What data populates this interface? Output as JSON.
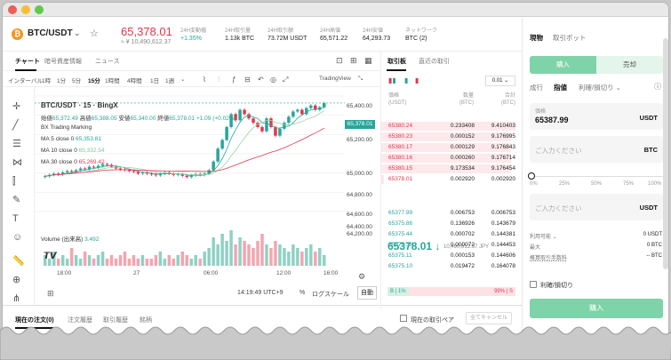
{
  "header": {
    "pair": "BTC/USDT",
    "dropdown": "⌄",
    "price": "65,378.01",
    "price_sub": "≈ ¥ 10,490,612.37",
    "stats": [
      {
        "label": "24H変動幅",
        "value": "+1.35%",
        "color": "#26a69a"
      },
      {
        "label": "24H取引量",
        "value": "1.13k BTC",
        "color": "#222222"
      },
      {
        "label": "24H取引額",
        "value": "73.72M USDT",
        "color": "#222222"
      },
      {
        "label": "24H高値",
        "value": "65,571.22",
        "color": "#222222"
      },
      {
        "label": "24H安値",
        "value": "64,293.73",
        "color": "#222222"
      },
      {
        "label": "ネットワーク",
        "value": "BTC (2)",
        "color": "#222222"
      }
    ]
  },
  "chart_tabs": [
    "チャート",
    "暗号資産情報",
    "ニュース"
  ],
  "intervals": [
    "インターバル",
    "1時",
    "1分",
    "5分",
    "15分",
    "1時間",
    "4時間",
    "1日",
    "1週",
    "⌄"
  ],
  "interval_active": "15分",
  "tradingview": "TradingView",
  "legend": {
    "title": "BTC/USDT · 15 · BingX",
    "ohlc_o_label": "始値",
    "ohlc_o": "65,372.49",
    "ohlc_h_label": "高値",
    "ohlc_h": "65,388.05",
    "ohlc_l_label": "安値",
    "ohlc_l": "65,340.00",
    "ohlc_c_label": "終値",
    "ohlc_c": "65,378.01",
    "ohlc_chg": "+1.09 (+0.02%)",
    "marking": "BX Trading Marking",
    "ma5_label": "MA 5 close 0",
    "ma5": "65,353.81",
    "ma10_label": "MA 10 close 0",
    "ma10": "65,332.54",
    "ma30_label": "MA 30 close 0",
    "ma30": "65,269.42",
    "volume_label": "Volume (出来高)",
    "volume": "3.492"
  },
  "chart_data": {
    "type": "candlestick",
    "y_ticks": [
      "65,400.00",
      "65,200.00",
      "65,000.00",
      "64,800.00",
      "64,600.00",
      "64,400.00",
      "64,200.00"
    ],
    "ylim": [
      64120,
      65460
    ],
    "x_ticks": [
      "18:00",
      "27",
      "06:00",
      "12:00",
      "16:00"
    ],
    "current_price": "65,378.01",
    "current_price_value": 65378.01,
    "closes": [
      64530,
      64545,
      64560,
      64550,
      64575,
      64590,
      64580,
      64600,
      64620,
      64610,
      64640,
      64630,
      64650,
      64670,
      64660,
      64640,
      64620,
      64610,
      64600,
      64590,
      64580,
      64560,
      64570,
      64560,
      64550,
      64540,
      64560,
      64575,
      64560,
      64545,
      64555,
      64535,
      64520,
      64540,
      64555,
      64545,
      64560,
      64600,
      64700,
      64850,
      64950,
      65100,
      65250,
      65180,
      65300,
      65250,
      65200,
      65150,
      65100,
      65050,
      65200,
      65100,
      65000,
      65080,
      65150,
      65220,
      65280,
      65300,
      65250,
      65320,
      65350,
      65300,
      65330,
      65378
    ],
    "ma_series": [
      {
        "name": "MA 5",
        "color": "#26a69a"
      },
      {
        "name": "MA 10",
        "color": "#9bd4a6"
      },
      {
        "name": "MA 30",
        "color": "#e3364d"
      }
    ],
    "volumes": [
      3,
      2,
      4,
      2,
      3,
      2,
      5,
      3,
      2,
      4,
      3,
      2,
      3,
      4,
      2,
      3,
      2,
      3,
      4,
      2,
      3,
      2,
      3,
      2,
      2,
      3,
      4,
      2,
      3,
      2,
      3,
      4,
      3,
      2,
      3,
      2,
      4,
      5,
      8,
      6,
      9,
      7,
      10,
      6,
      8,
      7,
      6,
      5,
      7,
      9,
      6,
      5,
      7,
      6,
      5,
      4,
      6,
      5,
      4,
      5,
      6,
      4,
      5,
      3
    ]
  },
  "time_status": "14:19:49 UTC+9",
  "chart_bottom": {
    "percent": "%",
    "log": "ログスケール",
    "auto": "自動"
  },
  "bottom_tabs": [
    "現在の注文(0)",
    "注文履歴",
    "取引履歴",
    "銘柄"
  ],
  "current_pair_label": "現在の取引ペア",
  "cancel_all": "全てキャンセル",
  "orderbook": {
    "tabs": [
      "取引板",
      "直近の取引"
    ],
    "precision": "0.01 ⌄",
    "headers": {
      "price": "価格",
      "price_unit": "(USDT)",
      "amount": "数量",
      "amount_unit": "(BTC)",
      "total": "合計",
      "total_unit": "(BTC)"
    },
    "asks": [
      {
        "price": "65380.24",
        "amount": "0.233408",
        "total": "9.410403",
        "depth": 0.95
      },
      {
        "price": "65380.23",
        "amount": "0.000152",
        "total": "9.176995",
        "depth": 0.92
      },
      {
        "price": "65380.17",
        "amount": "0.000129",
        "total": "9.176843",
        "depth": 0.92
      },
      {
        "price": "65380.16",
        "amount": "0.000260",
        "total": "9.176714",
        "depth": 0.92
      },
      {
        "price": "65380.15",
        "amount": "9.173534",
        "total": "9.176454",
        "depth": 0.92
      },
      {
        "price": "65378.01",
        "amount": "0.002920",
        "total": "0.002920",
        "depth": 0.02
      }
    ],
    "mid_price": "65378.01 ↓",
    "mid_sub": "10,490,612.37 JPY",
    "bids": [
      {
        "price": "65377.99",
        "amount": "0.006753",
        "total": "0.006753"
      },
      {
        "price": "65375.86",
        "amount": "0.136926",
        "total": "0.143679"
      },
      {
        "price": "65375.44",
        "amount": "0.000702",
        "total": "0.144381"
      },
      {
        "price": "65375.35",
        "amount": "0.000072",
        "total": "0.144453"
      },
      {
        "price": "65375.11",
        "amount": "0.000153",
        "total": "0.144606"
      },
      {
        "price": "65375.10",
        "amount": "0.019472",
        "total": "0.164078"
      }
    ],
    "buy_ratio": "B | 1%",
    "sell_ratio": "99% | S"
  },
  "panel": {
    "tabs": [
      "現物",
      "取引ボット"
    ],
    "buy": "購入",
    "sell": "売却",
    "order_types": [
      "成行",
      "指値",
      "利確/損切り ⌄"
    ],
    "price_label": "価格",
    "price_value": "65387.99",
    "price_unit": "USDT",
    "qty_placeholder": "ご入力ください",
    "qty_unit": "BTC",
    "total_placeholder": "ご入力ください",
    "total_unit": "USDT",
    "slider_marks": [
      "0%",
      "25%",
      "50%",
      "75%",
      "100%"
    ],
    "available_label": "利用可能 ⌄",
    "available_value": "0 USDT",
    "max_label": "最大",
    "max_value": "0 BTC",
    "fee_label": "概算取引手数料",
    "fee_value": "-- BTC",
    "tpsl": "利確/損切り",
    "buy_button": "購入"
  }
}
